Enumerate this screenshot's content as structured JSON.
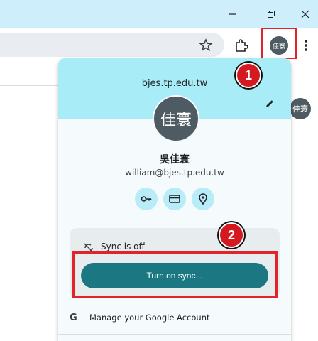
{
  "browser": {
    "profile_initials_small": "佳寰",
    "side_profile_initials": "佳寰"
  },
  "panel": {
    "domain": "bjes.tp.edu.tw",
    "avatar_initials": "佳寰",
    "name": "吳佳寰",
    "email": "william@bjes.tp.edu.tw",
    "quick_actions": [
      "key-icon",
      "card-icon",
      "location-icon"
    ],
    "sync_status": "Sync is off",
    "sync_button": "Turn on sync...",
    "manage_account": "Manage your Google Account",
    "google_glyph": "G"
  },
  "markers": [
    "1",
    "2"
  ],
  "colors": {
    "titlebar": "#cdeefa",
    "panel_header": "#a8ecf8",
    "sync_button": "#1b7882",
    "highlight": "#e3232c",
    "marker": "#d51920"
  }
}
